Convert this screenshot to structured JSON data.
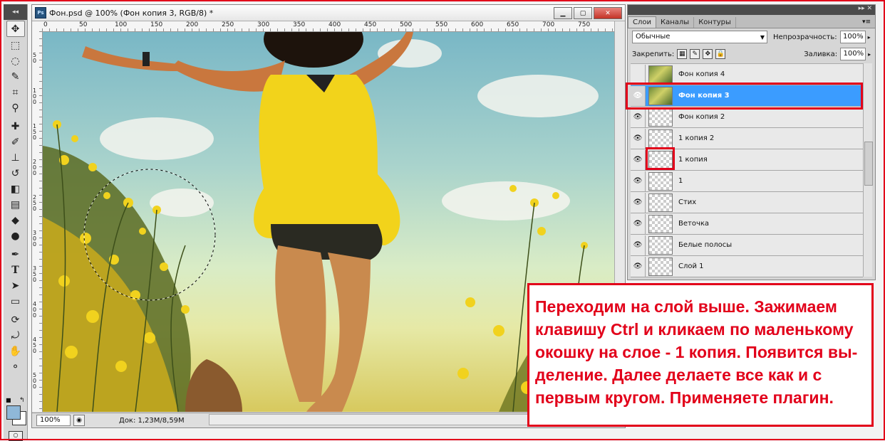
{
  "document": {
    "title": "Фон.psd @ 100% (Фон копия 3, RGB/8) *",
    "app_badge": "Ps",
    "status": {
      "zoom": "100%",
      "doc_info": "Док: 1,23M/8,59M"
    },
    "ruler_top_labels": [
      "0",
      "50",
      "100",
      "150",
      "200",
      "250",
      "300",
      "350",
      "400",
      "450",
      "500",
      "550",
      "600",
      "650",
      "700",
      "750"
    ],
    "ruler_left_labels": [
      "5 0",
      "1 0 0",
      "1 5 0",
      "2 0 0",
      "2 5 0",
      "3 0 0",
      "3 5 0",
      "4 0 0",
      "4 5 0",
      "5 0 0"
    ]
  },
  "layers_panel": {
    "tabs": [
      "Слои",
      "Каналы",
      "Контуры"
    ],
    "blend_mode": "Обычные",
    "opacity_label": "Непрозрачность:",
    "opacity": "100%",
    "lock_label": "Закрепить:",
    "fill_label": "Заливка:",
    "fill": "100%",
    "layers": [
      {
        "name": "Фон копия 4",
        "visible": false,
        "thumb": "photo"
      },
      {
        "name": "Фон копия 3",
        "visible": true,
        "thumb": "photo",
        "selected": true
      },
      {
        "name": "Фон копия 2",
        "visible": true,
        "thumb": "transparent"
      },
      {
        "name": "1 копия 2",
        "visible": true,
        "thumb": "transparent"
      },
      {
        "name": "1 копия",
        "visible": true,
        "thumb": "transparent"
      },
      {
        "name": "1",
        "visible": true,
        "thumb": "transparent"
      },
      {
        "name": "Стих",
        "visible": true,
        "thumb": "transparent"
      },
      {
        "name": "Веточка",
        "visible": true,
        "thumb": "transparent"
      },
      {
        "name": "Белые полосы",
        "visible": true,
        "thumb": "transparent"
      },
      {
        "name": "Слой 1",
        "visible": true,
        "thumb": "transparent"
      }
    ]
  },
  "annotation": {
    "text": "Переходим на слой выше. Зажимаем клавишу Ctrl и кликаем по маленькому окошку на слое - 1 копия. Появится вы-деление. Далее делаете все как и с первым кругом. Применяете плагин."
  },
  "colors": {
    "highlight": "#e2001a",
    "selection": "#3b9cff",
    "foreground_swatch": "#8fb8d8"
  }
}
